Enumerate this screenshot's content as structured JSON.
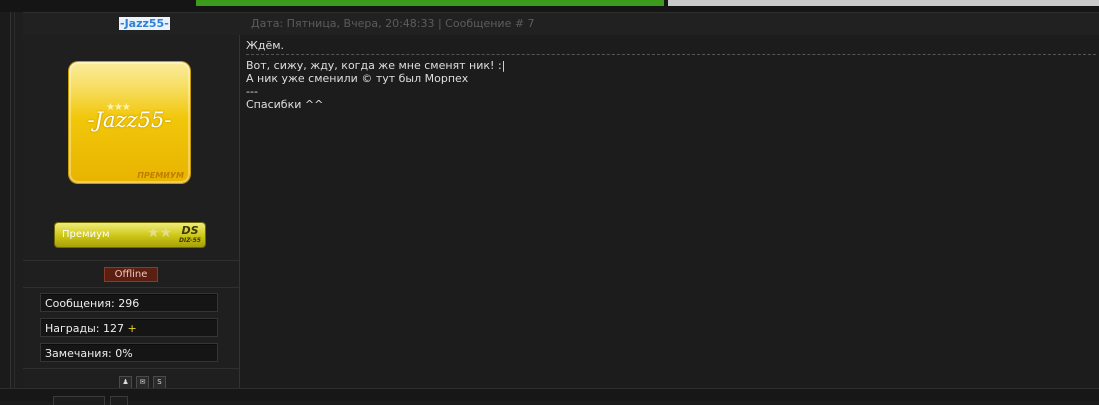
{
  "top_bars": {
    "green_color": "#3c9a1c",
    "gray_color": "#c9c9c9"
  },
  "header": {
    "username": "-Jazz55-",
    "meta": "Дата: Пятница, Вчера, 20:48:33 | Сообщение # 7"
  },
  "profile": {
    "avatar_text": "-Jazz55-",
    "avatar_tag": "ПРЕМИУМ",
    "rank_label": "Премиум",
    "rank_logo": "DS",
    "rank_logo_small": "DIZ-55",
    "status": "Offline",
    "stats": {
      "messages": "Сообщения: 296",
      "awards": "Награды: 127",
      "awards_plus": "+",
      "warnings": "Замечания: 0%"
    },
    "icons": [
      "profile-icon",
      "message-icon",
      "skype-icon"
    ]
  },
  "post": {
    "subject": "Ждём.",
    "lines": [
      "Вот, сижу, жду, когда же мне сменят ник! :|",
      "А ник уже сменили © тут был Морпех",
      "---",
      "Спасибки ^^"
    ]
  }
}
